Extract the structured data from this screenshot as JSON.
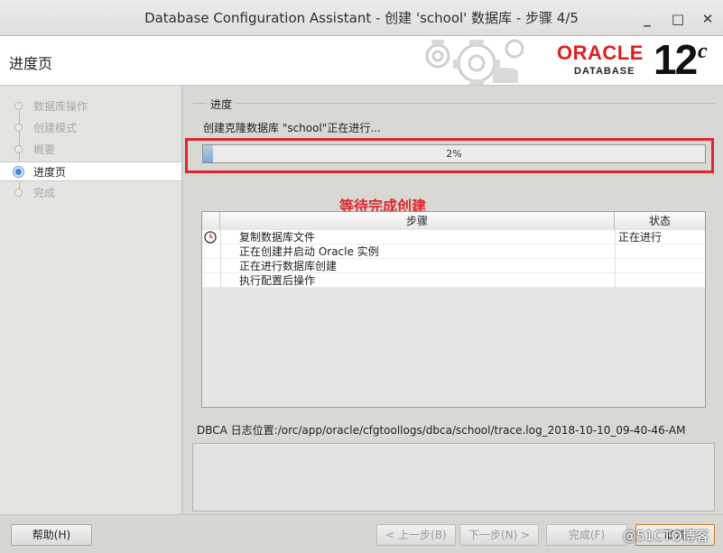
{
  "window": {
    "title": "Database Configuration Assistant - 创建 'school' 数据库 - 步骤 4/5",
    "controls": [
      "_",
      "□",
      "✕"
    ]
  },
  "header": {
    "page_title": "进度页",
    "logo_brand": "ORACLE",
    "logo_sub": "DATABASE",
    "logo_version": "12",
    "logo_suffix": "c"
  },
  "nav": {
    "items": [
      {
        "label": "数据库操作",
        "state": "done"
      },
      {
        "label": "创建模式",
        "state": "done"
      },
      {
        "label": "概要",
        "state": "done"
      },
      {
        "label": "进度页",
        "state": "active"
      },
      {
        "label": "完成",
        "state": "pending"
      }
    ]
  },
  "progress": {
    "section_label": "进度",
    "status_text": "创建克隆数据库 \"school\"正在进行...",
    "percent": 2,
    "percent_label": "2%"
  },
  "annotation": "等待完成创建",
  "steps_table": {
    "headers": {
      "step": "步骤",
      "status": "状态"
    },
    "rows": [
      {
        "step": "复制数据库文件",
        "status": "正在进行",
        "icon": "clock-icon"
      },
      {
        "step": "正在创建并启动 Oracle 实例",
        "status": "",
        "icon": ""
      },
      {
        "step": "正在进行数据库创建",
        "status": "",
        "icon": ""
      },
      {
        "step": "执行配置后操作",
        "status": "",
        "icon": ""
      }
    ]
  },
  "log": {
    "text": "DBCA 日志位置:/orc/app/oracle/cfgtoollogs/dbca/school/trace.log_2018-10-10_09-40-46-AM"
  },
  "buttons": {
    "help": "帮助(H)",
    "back": "< 上一步(B)",
    "next": "下一步(N) >",
    "finish": "完成(F)",
    "cancel": "取消"
  },
  "watermark": "@51CTO博客",
  "colors": {
    "highlight_red": "#e0242c",
    "oracle_red": "#e01d1d",
    "progress_blue": "#7ea6d3"
  }
}
